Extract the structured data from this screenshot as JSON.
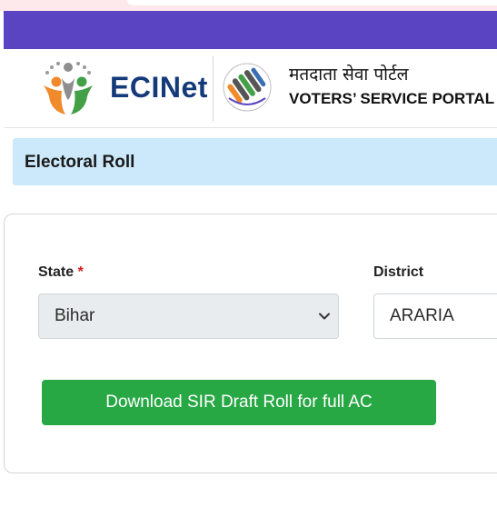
{
  "header": {
    "brand_name": "ECINet",
    "portal_title_hindi": "मतदाता सेवा पोर्टल",
    "portal_title_english": "VOTERS’ SERVICE PORTAL",
    "top_bar_color": "#5a44c2"
  },
  "section": {
    "title": "Electoral Roll",
    "banner_color": "#cce8fb"
  },
  "form": {
    "state_label": "State",
    "required_marker": "*",
    "state_value": "Bihar",
    "district_label": "District",
    "district_value": "ARARIA",
    "download_label": "Download SIR Draft Roll for full AC",
    "button_color": "#28a745"
  },
  "icons": {
    "brand_logo": "ecinet-logo-icon",
    "portal_logo": "voter-portal-emblem-icon",
    "select_arrow": "chevron-down-icon"
  }
}
